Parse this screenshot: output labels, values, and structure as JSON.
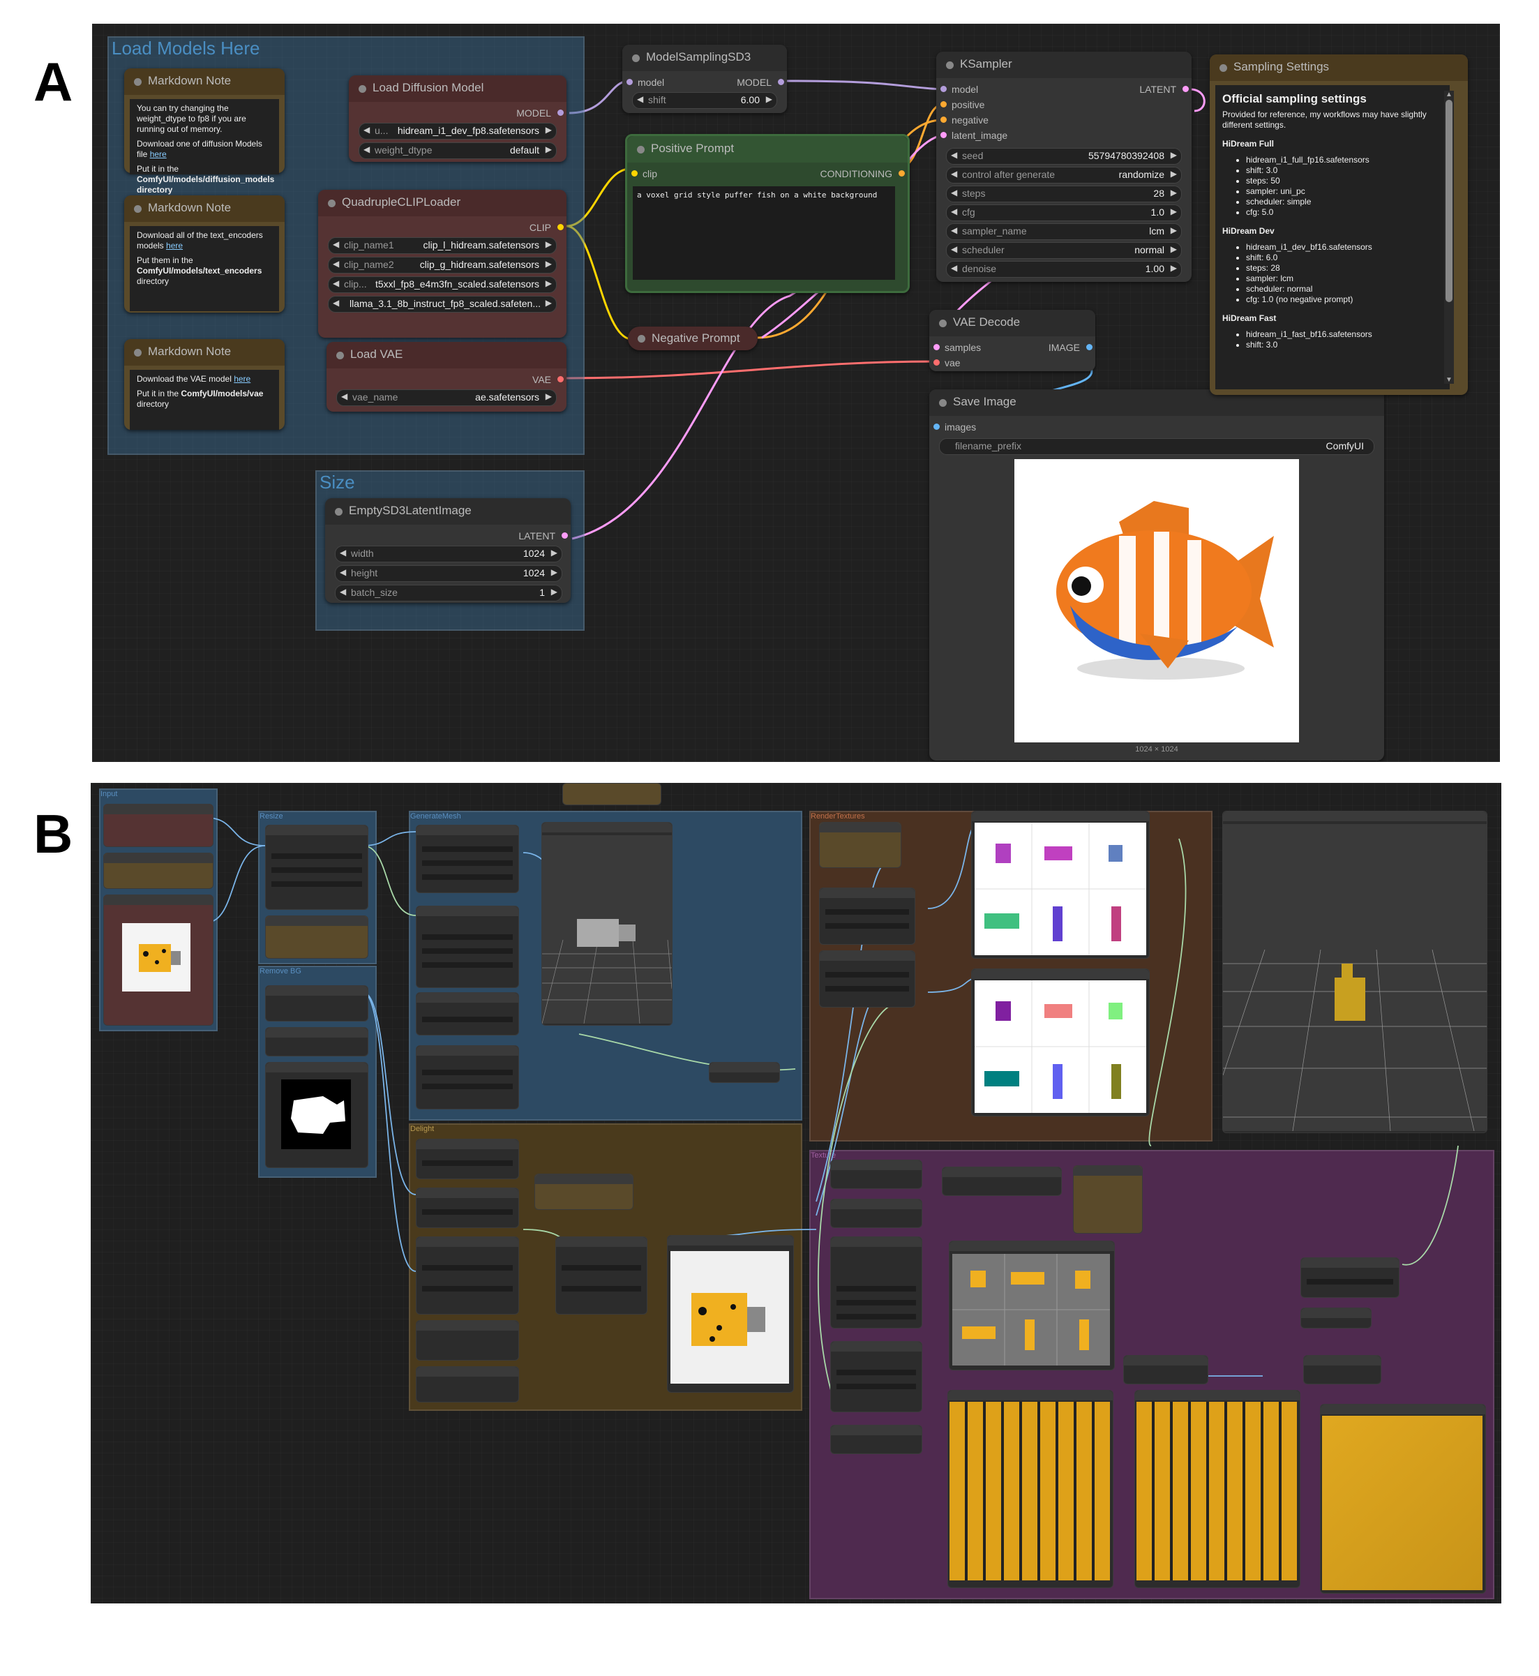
{
  "panel_a": {
    "label": "A",
    "group_models_title": "Load Models Here",
    "group_size_title": "Size",
    "md1": {
      "title": "Markdown Note",
      "line1": "You can try changing the weight_dtype to fp8 if you are running out of memory.",
      "line2": "Download one of diffusion Models file ",
      "link": "here",
      "line3": "Put it in the ",
      "path": "ComfyUI/models/diffusion_models directory"
    },
    "md2": {
      "title": "Markdown Note",
      "line1": "Download all of the text_encoders models ",
      "link": "here",
      "line2": "Put them in the ",
      "path": "ComfyUI/models/text_encoders",
      "line3": "directory"
    },
    "md3": {
      "title": "Markdown Note",
      "line1": "Download the VAE model ",
      "link": "here",
      "line2": "Put it in the ",
      "path": "ComfyUI/models/vae",
      "line3": "directory"
    },
    "load_diffusion": {
      "title": "Load Diffusion Model",
      "output": "MODEL",
      "w1_name": "u...",
      "w1_value": "hidream_i1_dev_fp8.safetensors",
      "w2_name": "weight_dtype",
      "w2_value": "default"
    },
    "clip_loader": {
      "title": "QuadrupleCLIPLoader",
      "output": "CLIP",
      "w": [
        {
          "name": "clip_name1",
          "value": "clip_l_hidream.safetensors"
        },
        {
          "name": "clip_name2",
          "value": "clip_g_hidream.safetensors"
        },
        {
          "name": "clip...",
          "value": "t5xxl_fp8_e4m3fn_scaled.safetensors"
        },
        {
          "name": "",
          "value": "llama_3.1_8b_instruct_fp8_scaled.safeten..."
        }
      ]
    },
    "load_vae": {
      "title": "Load VAE",
      "output": "VAE",
      "w_name": "vae_name",
      "w_value": "ae.safetensors"
    },
    "latent": {
      "title": "EmptySD3LatentImage",
      "output": "LATENT",
      "w": [
        {
          "name": "width",
          "value": "1024"
        },
        {
          "name": "height",
          "value": "1024"
        },
        {
          "name": "batch_size",
          "value": "1"
        }
      ]
    },
    "model_sampling": {
      "title": "ModelSamplingSD3",
      "input": "model",
      "output": "MODEL",
      "w_name": "shift",
      "w_value": "6.00"
    },
    "positive": {
      "title": "Positive Prompt",
      "input": "clip",
      "output": "CONDITIONING",
      "text": "a voxel grid style puffer fish on a white background"
    },
    "negative": {
      "title": "Negative Prompt"
    },
    "ksampler": {
      "title": "KSampler",
      "inputs": [
        "model",
        "positive",
        "negative",
        "latent_image"
      ],
      "output": "LATENT",
      "w": [
        {
          "name": "seed",
          "value": "55794780392408"
        },
        {
          "name": "control after generate",
          "value": "randomize"
        },
        {
          "name": "steps",
          "value": "28"
        },
        {
          "name": "cfg",
          "value": "1.0"
        },
        {
          "name": "sampler_name",
          "value": "lcm"
        },
        {
          "name": "scheduler",
          "value": "normal"
        },
        {
          "name": "denoise",
          "value": "1.00"
        }
      ]
    },
    "vae_decode": {
      "title": "VAE Decode",
      "inputs": [
        "samples",
        "vae"
      ],
      "output": "IMAGE"
    },
    "save_image": {
      "title": "Save Image",
      "input": "images",
      "w_name": "filename_prefix",
      "w_value": "ComfyUI",
      "caption": "1024 × 1024"
    },
    "settings": {
      "title": "Sampling Settings",
      "heading": "Official sampling settings",
      "intro": "Provided for reference, my workflows may have slightly different settings.",
      "sections": [
        {
          "name": "HiDream Full",
          "items": [
            "hidream_i1_full_fp16.safetensors",
            "shift: 3.0",
            "steps: 50",
            "sampler: uni_pc",
            "scheduler: simple",
            "cfg: 5.0"
          ]
        },
        {
          "name": "HiDream Dev",
          "items": [
            "hidream_i1_dev_bf16.safetensors",
            "shift: 6.0",
            "steps: 28",
            "sampler: lcm",
            "scheduler: normal",
            "cfg: 1.0 (no negative prompt)"
          ]
        },
        {
          "name": "HiDream Fast",
          "items": [
            "hidream_i1_fast_bf16.safetensors",
            "shift: 3.0"
          ]
        }
      ]
    }
  },
  "panel_b": {
    "label": "B",
    "groups": {
      "input": "Input",
      "resize": "Resize",
      "remove_bg": "Remove BG",
      "generate_mesh": "GenerateMesh",
      "delight": "Delight",
      "render_textures": "RenderTextures",
      "texture": "Texture"
    }
  },
  "colors": {
    "canvas": "#202020",
    "group_blue": "#2d4a63",
    "group_brown": "#4a3a1c",
    "group_brown2": "#4a3121",
    "group_purple": "#4f2a4f",
    "node_body": "#353535",
    "model_wire": "#b39ddb",
    "clip_wire": "#ffd500",
    "vae_wire": "#ff6e6e",
    "latent_wire": "#ff9cf9",
    "image_wire": "#64b5f6",
    "cond_wire": "#ffa931"
  }
}
